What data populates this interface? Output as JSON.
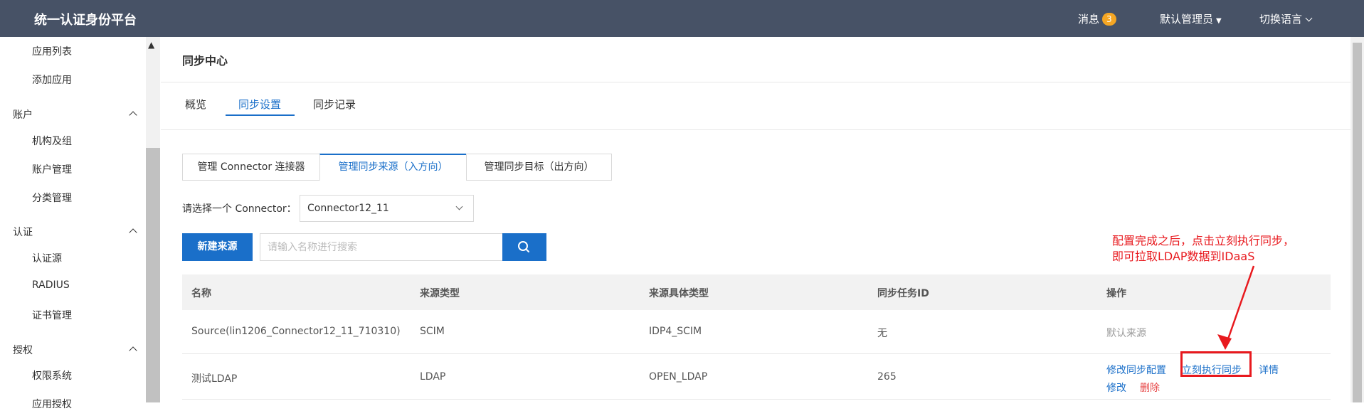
{
  "header": {
    "brand": "统一认证身份平台",
    "messages_label": "消息",
    "messages_count": "3",
    "admin_label": "默认管理员",
    "lang_label": "切换语言"
  },
  "sidebar": {
    "items": [
      {
        "type": "item",
        "label": "应用列表"
      },
      {
        "type": "item",
        "label": "添加应用"
      },
      {
        "type": "group",
        "label": "账户"
      },
      {
        "type": "item",
        "label": "机构及组"
      },
      {
        "type": "item",
        "label": "账户管理"
      },
      {
        "type": "item",
        "label": "分类管理"
      },
      {
        "type": "group",
        "label": "认证"
      },
      {
        "type": "item",
        "label": "认证源"
      },
      {
        "type": "item",
        "label": "RADIUS"
      },
      {
        "type": "item",
        "label": "证书管理"
      },
      {
        "type": "group",
        "label": "授权"
      },
      {
        "type": "item",
        "label": "权限系统"
      },
      {
        "type": "item",
        "label": "应用授权"
      }
    ]
  },
  "main": {
    "page_title": "同步中心",
    "tabs": [
      "概览",
      "同步设置",
      "同步记录"
    ],
    "subtabs": [
      "管理 Connector 连接器",
      "管理同步来源（入方向）",
      "管理同步目标（出方向）"
    ],
    "connector_label": "请选择一个 Connector：",
    "connector_value": "Connector12_11",
    "new_source_button": "新建来源",
    "search_placeholder": "请输入名称进行搜索",
    "table": {
      "headers": [
        "名称",
        "来源类型",
        "来源具体类型",
        "同步任务ID",
        "操作"
      ],
      "rows": [
        {
          "name": "Source(lin1206_Connector12_11_710310)",
          "type": "SCIM",
          "subtype": "IDP4_SCIM",
          "task_id": "无",
          "action_default": "默认来源"
        },
        {
          "name": "测试LDAP",
          "type": "LDAP",
          "subtype": "OPEN_LDAP",
          "task_id": "265",
          "actions": {
            "modify_config": "修改同步配置",
            "sync_now": "立刻执行同步",
            "detail": "详情",
            "modify": "修改",
            "delete": "删除"
          }
        }
      ]
    }
  },
  "annotation": {
    "line1": "配置完成之后，点击立刻执行同步，",
    "line2": "即可拉取LDAP数据到IDaaS",
    "color": "#e8191e"
  },
  "colors": {
    "header_bg": "#475266",
    "accent": "#1a6fc9",
    "badge": "#f5a623"
  }
}
